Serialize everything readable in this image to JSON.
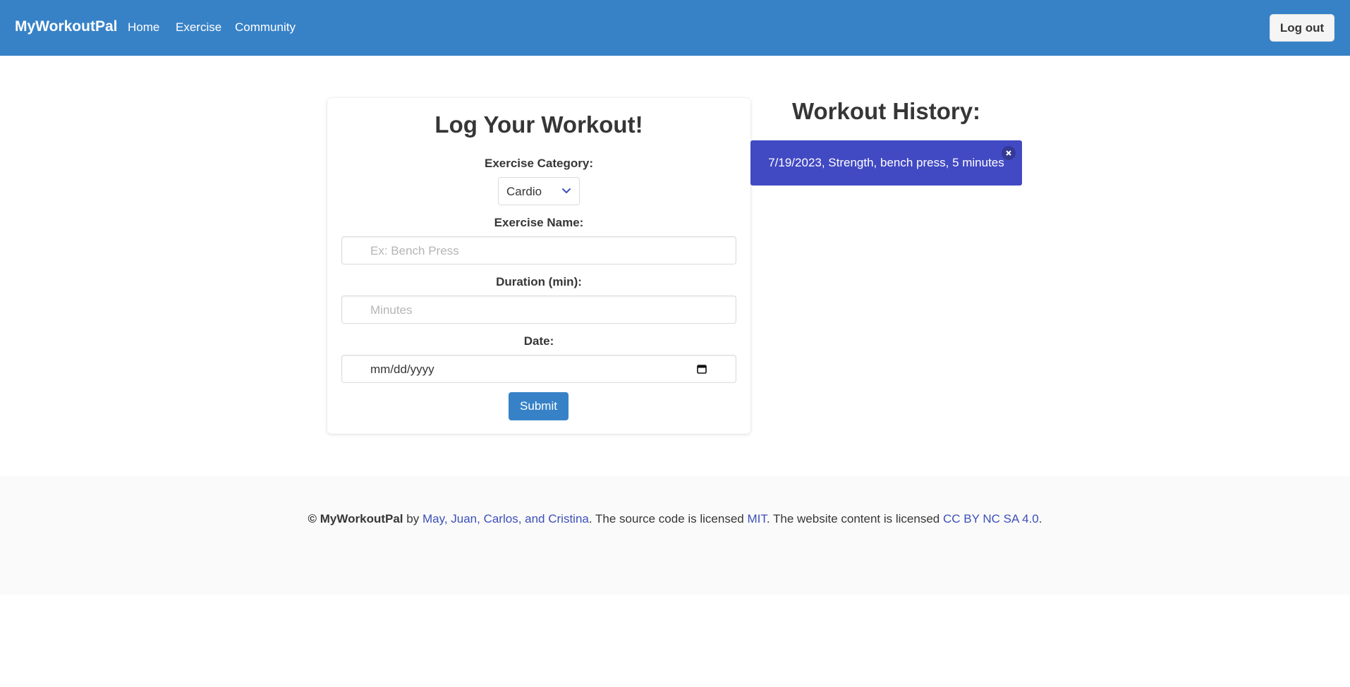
{
  "navbar": {
    "brand": "MyWorkoutPal",
    "links": [
      "Home",
      "Exercise",
      "Community"
    ],
    "logout_label": "Log out"
  },
  "form": {
    "title": "Log Your Workout!",
    "category_label": "Exercise Category:",
    "category_value": "Cardio",
    "name_label": "Exercise Name:",
    "name_placeholder": "Ex: Bench Press",
    "duration_label": "Duration (min):",
    "duration_placeholder": "Minutes",
    "date_label": "Date:",
    "date_placeholder": "mm/dd/yyyy",
    "submit_label": "Submit"
  },
  "history": {
    "title": "Workout History:",
    "items": [
      {
        "text": "7/19/2023, Strength, bench press, 5 minutes",
        "delete_label": "×"
      }
    ]
  },
  "footer": {
    "copyright_symbol": "©",
    "brand": "MyWorkoutPal",
    "by_text": "by",
    "authors": "May, Juan, Carlos, and Cristina",
    "source_text": ". The source code is licensed",
    "source_license": "MIT",
    "content_text": ". The website content is licensed",
    "content_license": "CC BY NC SA 4.0",
    "end_text": "."
  },
  "colors": {
    "primary": "#3782c7",
    "history_item": "#4149c3",
    "link": "#3d4fb8",
    "footer_bg": "#fafafa"
  },
  "icons": {
    "category_dropdown": "chevron-down-icon",
    "date_picker": "calendar-icon",
    "delete_entry": "close-icon"
  }
}
